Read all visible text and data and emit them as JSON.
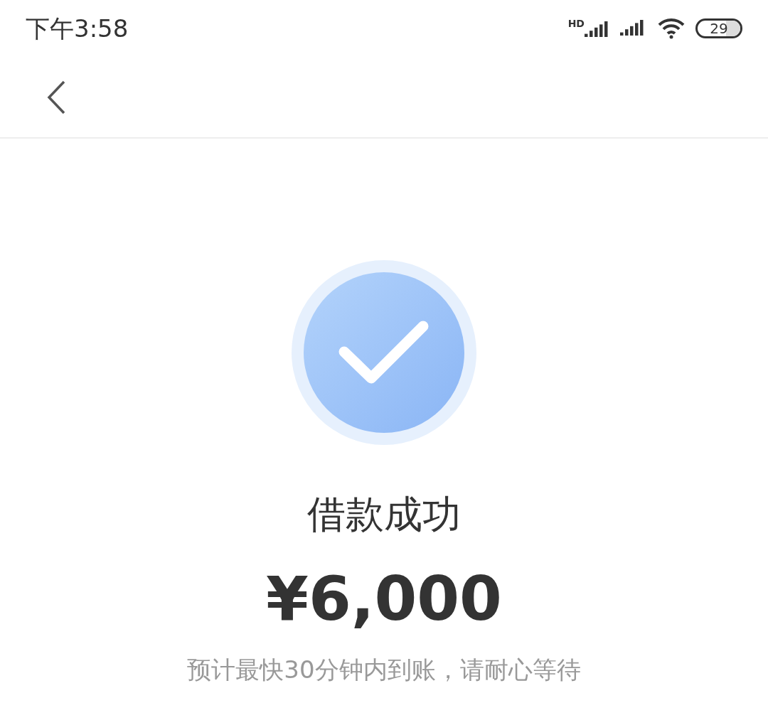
{
  "status_bar": {
    "time": "下午3:58",
    "network_label": "HD",
    "battery": "29"
  },
  "result": {
    "title": "借款成功",
    "amount": "¥6,000",
    "note": "预计最快30分钟内到账，请耐心等待"
  }
}
